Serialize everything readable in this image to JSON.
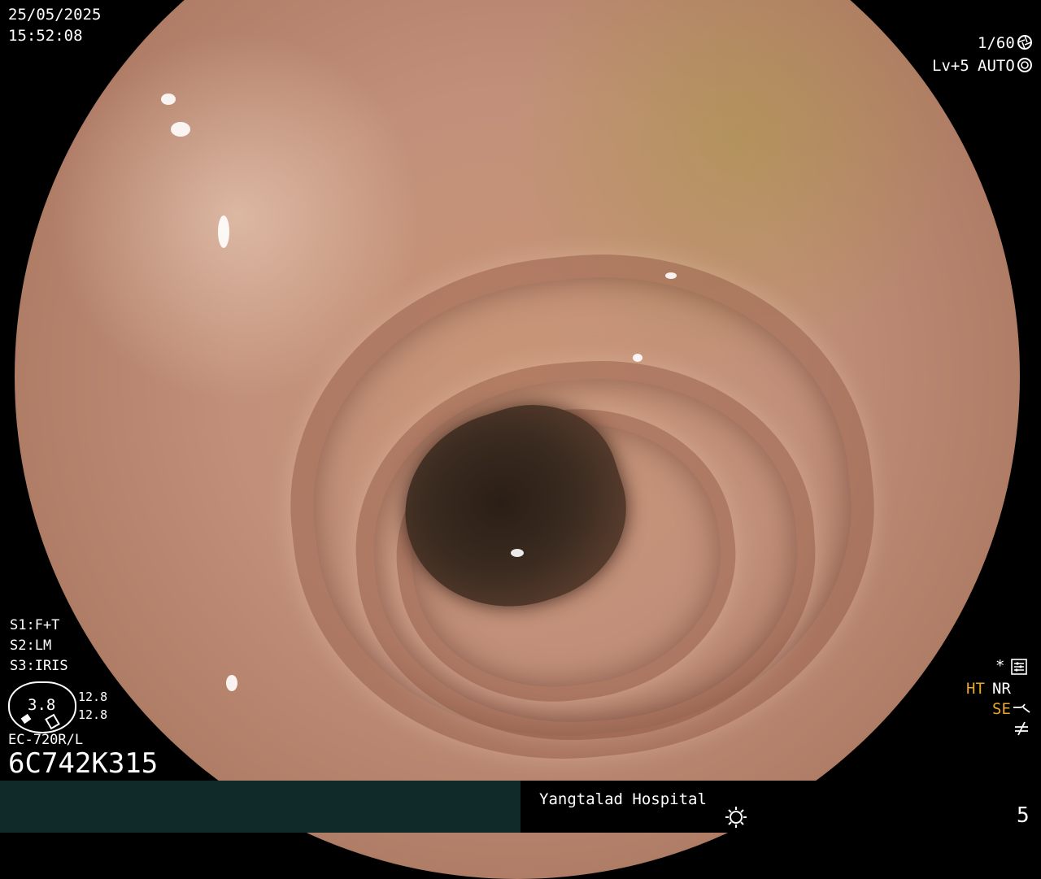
{
  "overlay": {
    "date": "25/05/2025",
    "time": "15:52:08",
    "shutter": "1/60",
    "shutter_icon": "aperture-icon",
    "level": "Lv+5",
    "auto": "AUTO",
    "auto_icon": "iris-icon",
    "s1": "S1:F+T",
    "s2": "S2:LM",
    "s3": "S3:IRIS",
    "gauge_value": "3.8",
    "gauge_top": "12.8",
    "gauge_bottom": "12.8",
    "scope_model": "EC-720R/L",
    "serial": "6C742K315",
    "star": "*",
    "settings_icon": "settings-icon",
    "ht": "HT",
    "nr": "NR",
    "se": "SE",
    "se_icon": "curve-icon",
    "ne_icon": "not-equal-icon"
  },
  "footer": {
    "hospital": "Yangtalad Hospital",
    "light_icon": "sun-icon",
    "number": "5"
  },
  "colors": {
    "footer_left": "#0f2a28",
    "accent": "#e8a72a"
  }
}
